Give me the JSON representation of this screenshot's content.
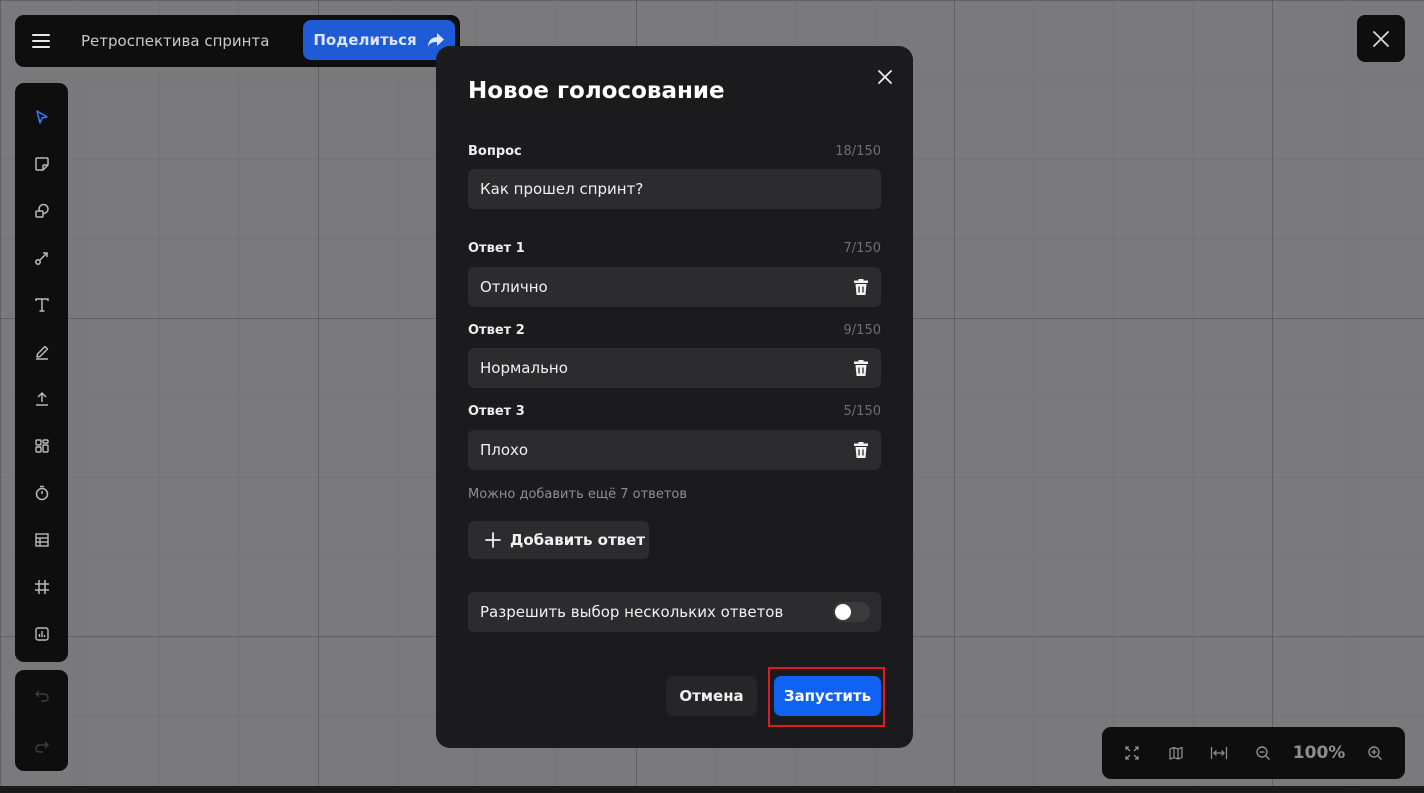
{
  "header": {
    "board_title": "Ретроспектива спринта",
    "share_label": "Поделиться"
  },
  "toolbar": {
    "tools": [
      "select-icon",
      "sticky-note-icon",
      "shapes-icon",
      "connector-icon",
      "text-icon",
      "pen-icon",
      "upload-icon",
      "templates-icon",
      "timer-icon",
      "table-icon",
      "frame-icon",
      "chart-icon"
    ],
    "active_tool": "select-icon"
  },
  "history": [
    "undo-icon",
    "redo-icon"
  ],
  "zoom": {
    "level": "100%",
    "icons": [
      "fit-screen-icon",
      "map-icon",
      "fit-width-icon",
      "zoom-out-icon",
      "zoom-in-icon"
    ]
  },
  "modal": {
    "title": "Новое голосование",
    "question": {
      "label": "Вопрос",
      "count": "18/150",
      "value": "Как прошел спринт?"
    },
    "answers": [
      {
        "label": "Ответ 1",
        "count": "7/150",
        "value": "Отлично"
      },
      {
        "label": "Ответ 2",
        "count": "9/150",
        "value": "Нормально"
      },
      {
        "label": "Ответ 3",
        "count": "5/150",
        "value": "Плохо"
      }
    ],
    "hint": "Можно добавить ещё 7 ответов",
    "add_answer_label": "Добавить ответ",
    "multiple_choice_label": "Разрешить выбор нескольких ответов",
    "multiple_choice_enabled": false,
    "cancel_label": "Отмена",
    "start_label": "Запустить"
  },
  "colors": {
    "accent": "#1062f3",
    "share": "#1f5bd6",
    "highlight_border": "#e01b24",
    "modal_bg": "#1b1b1d",
    "field_bg": "#2c2c2e"
  }
}
